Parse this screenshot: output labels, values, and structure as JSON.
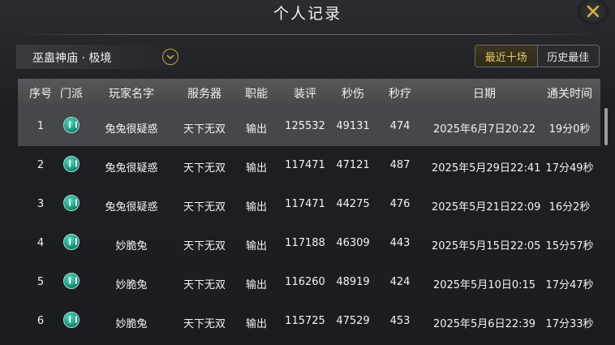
{
  "window": {
    "title": "个人记录"
  },
  "dungeon": {
    "label": "巫蛊神庙 · 极境"
  },
  "toggles": [
    {
      "label": "最近十场",
      "active": true
    },
    {
      "label": "历史最佳",
      "active": false
    }
  ],
  "table": {
    "headers": {
      "index": "序号",
      "sect": "门派",
      "player": "玩家名字",
      "server": "服务器",
      "role": "职能",
      "gear": "装评",
      "dps": "秒伤",
      "hps": "秒疗",
      "date": "日期",
      "time": "通关时间"
    },
    "rows": [
      {
        "index": "1",
        "sect_icon": "jade-sect-icon",
        "player": "兔兔很疑惑",
        "server": "天下无双",
        "role": "输出",
        "gear": "125532",
        "dps": "49131",
        "hps": "474",
        "date": "2025年6月7日20:22",
        "time": "19分0秒"
      },
      {
        "index": "2",
        "sect_icon": "jade-sect-icon",
        "player": "兔兔很疑惑",
        "server": "天下无双",
        "role": "输出",
        "gear": "117471",
        "dps": "47121",
        "hps": "487",
        "date": "2025年5月29日22:41",
        "time": "17分49秒"
      },
      {
        "index": "3",
        "sect_icon": "jade-sect-icon",
        "player": "兔兔很疑惑",
        "server": "天下无双",
        "role": "输出",
        "gear": "117471",
        "dps": "44275",
        "hps": "476",
        "date": "2025年5月21日22:09",
        "time": "16分2秒"
      },
      {
        "index": "4",
        "sect_icon": "jade-sect-icon",
        "player": "妙脆兔",
        "server": "天下无双",
        "role": "输出",
        "gear": "117188",
        "dps": "46309",
        "hps": "443",
        "date": "2025年5月15日22:05",
        "time": "15分57秒"
      },
      {
        "index": "5",
        "sect_icon": "jade-sect-icon",
        "player": "妙脆兔",
        "server": "天下无双",
        "role": "输出",
        "gear": "116260",
        "dps": "48919",
        "hps": "424",
        "date": "2025年5月10日0:15",
        "time": "17分47秒"
      },
      {
        "index": "6",
        "sect_icon": "jade-sect-icon",
        "player": "妙脆兔",
        "server": "天下无双",
        "role": "输出",
        "gear": "115725",
        "dps": "47529",
        "hps": "453",
        "date": "2025年5月6日22:39",
        "time": "17分33秒"
      }
    ]
  },
  "colors": {
    "accent_gold": "#e6c867",
    "sect_jade": "#1a8e78"
  }
}
